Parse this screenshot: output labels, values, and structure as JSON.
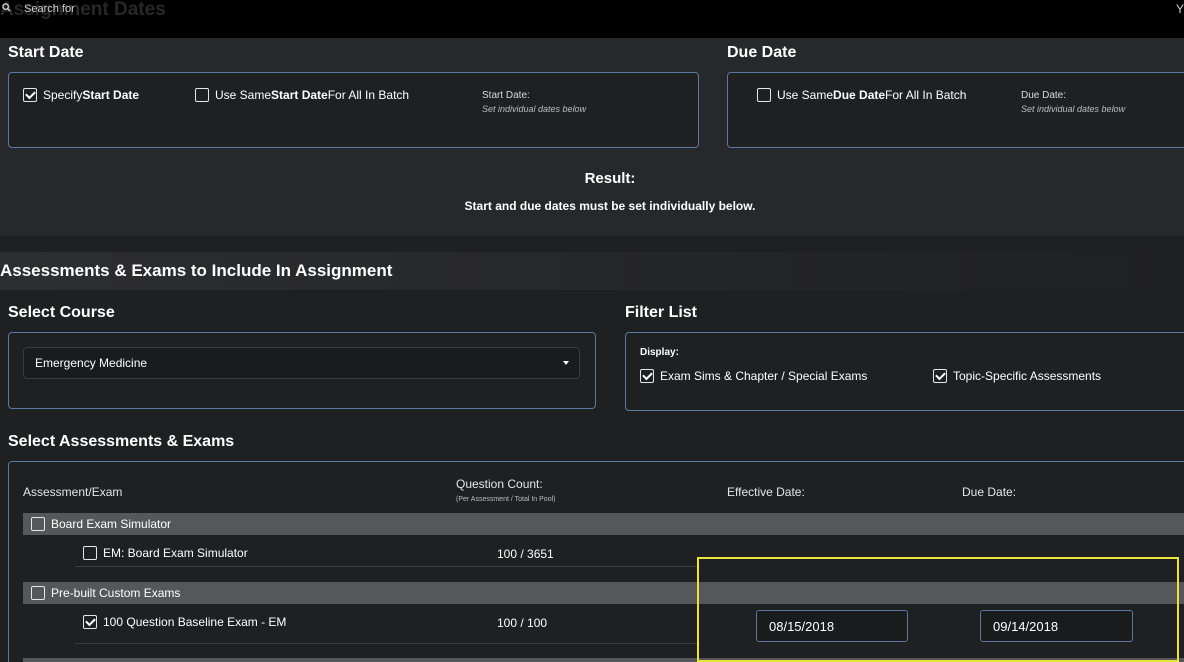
{
  "topbar": {
    "search_placeholder": "Search for",
    "ghost_title": "Assignment Dates",
    "corner_mark": "Y"
  },
  "start_date": {
    "heading": "Start Date",
    "specify_checkbox": {
      "prefix": "Specify ",
      "bold": "Start Date",
      "checked": true
    },
    "same_checkbox": {
      "prefix": "Use Same ",
      "bold": "Start Date",
      "suffix": " For All In Batch",
      "checked": false
    },
    "field_label": "Start Date:",
    "field_hint": "Set individual dates below"
  },
  "due_date": {
    "heading": "Due Date",
    "same_checkbox": {
      "prefix": "Use Same ",
      "bold": "Due Date",
      "suffix": " For All In Batch",
      "checked": false
    },
    "field_label": "Due Date:",
    "field_hint": "Set individual dates below"
  },
  "result": {
    "title": "Result:",
    "text": "Start and due dates must be set individually below."
  },
  "assessments_heading": "Assessments & Exams to Include In Assignment",
  "select_course": {
    "heading": "Select Course",
    "selected": "Emergency Medicine"
  },
  "filter_list": {
    "heading": "Filter List",
    "display_label": "Display:",
    "options": [
      {
        "label": "Exam Sims & Chapter / Special Exams",
        "checked": true
      },
      {
        "label": "Topic-Specific Assessments",
        "checked": true
      }
    ]
  },
  "select_assessments": {
    "heading": "Select Assessments & Exams",
    "columns": {
      "exam": "Assessment/Exam",
      "count": "Question Count:",
      "count_sub": "(Per Assessment / Total In Pool)",
      "effective": "Effective Date:",
      "due": "Due Date:"
    },
    "groups": [
      {
        "label": "Board Exam Simulator",
        "checked": false,
        "items": [
          {
            "label": "EM: Board Exam Simulator",
            "count": "100 / 3651",
            "checked": false
          }
        ]
      },
      {
        "label": "Pre-built Custom Exams",
        "checked": false,
        "items": [
          {
            "label": "100 Question Baseline Exam - EM",
            "count": "100 / 100",
            "checked": true,
            "effective_date": "08/15/2018",
            "due_date": "09/14/2018"
          }
        ]
      }
    ]
  },
  "colors": {
    "accent_border": "#5b79a3",
    "highlight": "#e8e53a",
    "background": "#1f2022"
  }
}
